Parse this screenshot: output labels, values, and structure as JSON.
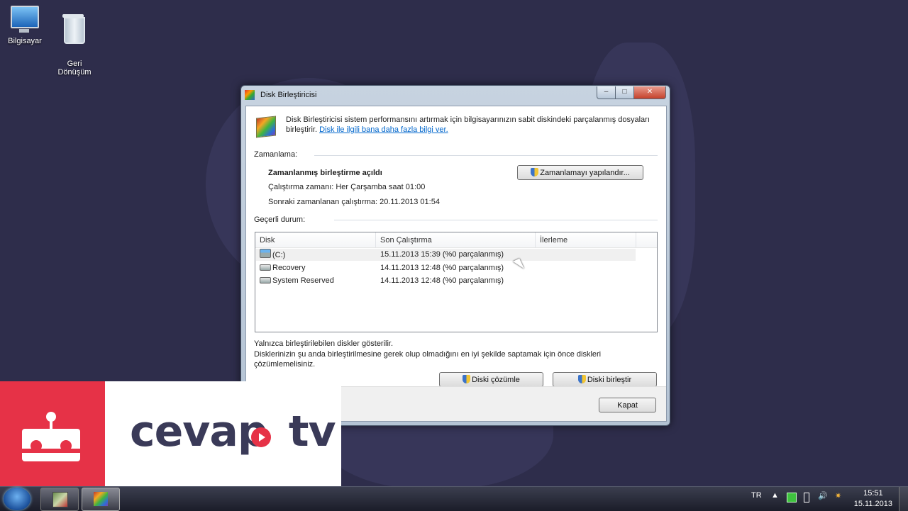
{
  "desktop": {
    "icons": [
      {
        "label": "Bilgisayar",
        "icon": "computer-icon"
      },
      {
        "label": "Geri\nDönüşüm",
        "icon": "recycle-bin-icon"
      }
    ]
  },
  "window": {
    "title": "Disk Birleştiricisi",
    "controls": {
      "minimize": "–",
      "maximize": "□",
      "close": "✕"
    },
    "intro_line1": "Disk Birleştiricisi sistem performansını artırmak için bilgisayarınızın sabit diskindeki parçalanmış dosyaları",
    "intro_line2_prefix": "birleştirir. ",
    "intro_link": "Disk ile ilgili bana daha fazla bilgi ver.",
    "schedule": {
      "section_label": "Zamanlama:",
      "status": "Zamanlanmış birleştirme açıldı",
      "run_time": "Çalıştırma zamanı: Her Çarşamba saat 01:00",
      "next_run": "Sonraki zamanlanan çalıştırma: 20.11.2013 01:54",
      "configure_button": "Zamanlamayı yapılandır..."
    },
    "current_status": {
      "section_label": "Geçerli durum:",
      "columns": [
        "Disk",
        "Son Çalıştırma",
        "İlerleme"
      ],
      "rows": [
        {
          "disk": "(C:)",
          "last_run": "15.11.2013 15:39 (%0 parçalanmış)",
          "progress": "",
          "icon": "system-drive-icon"
        },
        {
          "disk": "Recovery",
          "last_run": "14.11.2013 12:48 (%0 parçalanmış)",
          "progress": "",
          "icon": "drive-icon"
        },
        {
          "disk": "System Reserved",
          "last_run": "14.11.2013 12:48 (%0 parçalanmış)",
          "progress": "",
          "icon": "drive-icon"
        }
      ]
    },
    "note1": "Yalnızca birleştirilebilen diskler gösterilir.",
    "note2": "Disklerinizin şu anda birleştirilmesine gerek olup olmadığını en iyi şekilde saptamak için önce diskleri",
    "note3": "çözümlemelisiniz.",
    "analyze_button": "Diski çözümle",
    "defrag_button": "Diski birleştir",
    "close_button": "Kapat"
  },
  "watermark": {
    "brand_left": "cevap",
    "brand_right": "tv"
  },
  "taskbar": {
    "language": "TR",
    "time": "15:51",
    "date": "15.11.2013"
  }
}
